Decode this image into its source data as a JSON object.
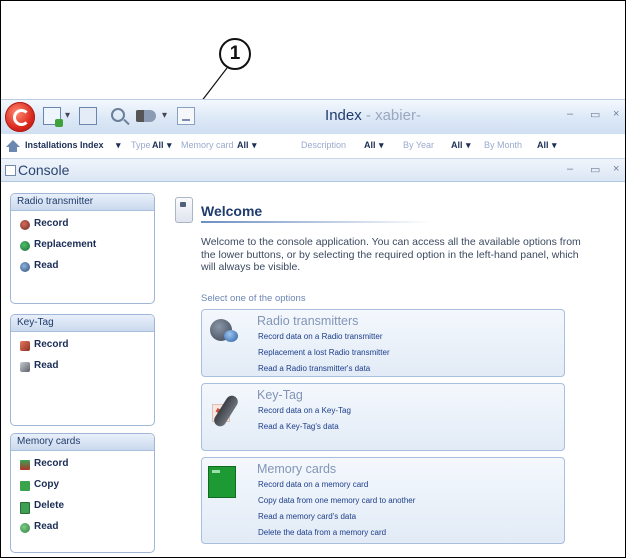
{
  "callout": {
    "number": "1"
  },
  "window": {
    "title": "Index",
    "title_separator": " - ",
    "title_user": "xabier-",
    "minimize": "–",
    "maximize": "▭",
    "close": "×"
  },
  "toolbar": {
    "dropdown_arrow": "▾",
    "icons": [
      "app-logo",
      "new-icon",
      "save-icon",
      "search-icon",
      "tool-icon",
      "settings-icon"
    ]
  },
  "index_bar": {
    "label": "Installations Index",
    "filters": [
      {
        "label": "Type",
        "value": "All"
      },
      {
        "label": "Memory card",
        "value": "All"
      },
      {
        "label": "Description",
        "value": "All"
      },
      {
        "label": "By Year",
        "value": "All"
      },
      {
        "label": "By Month",
        "value": "All"
      }
    ]
  },
  "console": {
    "title": "Console",
    "minimize": "–",
    "maximize": "▭",
    "close": "×"
  },
  "sidebar": {
    "groups": [
      {
        "title": "Radio transmitter",
        "items": [
          {
            "label": "Record",
            "icon": "radio-record-icon"
          },
          {
            "label": "Replacement",
            "icon": "radio-replacement-icon"
          },
          {
            "label": "Read",
            "icon": "radio-read-icon"
          }
        ]
      },
      {
        "title": "Key-Tag",
        "items": [
          {
            "label": "Record",
            "icon": "keytag-record-icon"
          },
          {
            "label": "Read",
            "icon": "keytag-read-icon"
          }
        ]
      },
      {
        "title": "Memory cards",
        "items": [
          {
            "label": "Record",
            "icon": "memory-record-icon"
          },
          {
            "label": "Copy",
            "icon": "memory-copy-icon"
          },
          {
            "label": "Delete",
            "icon": "memory-delete-icon"
          },
          {
            "label": "Read",
            "icon": "memory-read-icon"
          }
        ]
      }
    ]
  },
  "main": {
    "welcome_title": "Welcome",
    "welcome_text": "Welcome to the console application. You can access all the available options from the lower buttons, or by selecting the required option in the left-hand panel, which will always be visible.",
    "select_label": "Select one of the options",
    "cards": [
      {
        "title": "Radio transmitters",
        "links": [
          "Record data on a Radio transmitter",
          "Replacement  a lost Radio transmitter",
          "Read a Radio transmitter's data"
        ]
      },
      {
        "title": "Key-Tag",
        "links": [
          "Record data on a Key-Tag",
          "Read a Key-Tag's data"
        ]
      },
      {
        "title": "Memory cards",
        "links": [
          "Record data on a memory card",
          "Copy data from one memory card to another",
          "Read a memory card's data",
          "Delete the data from a memory card"
        ]
      }
    ]
  }
}
